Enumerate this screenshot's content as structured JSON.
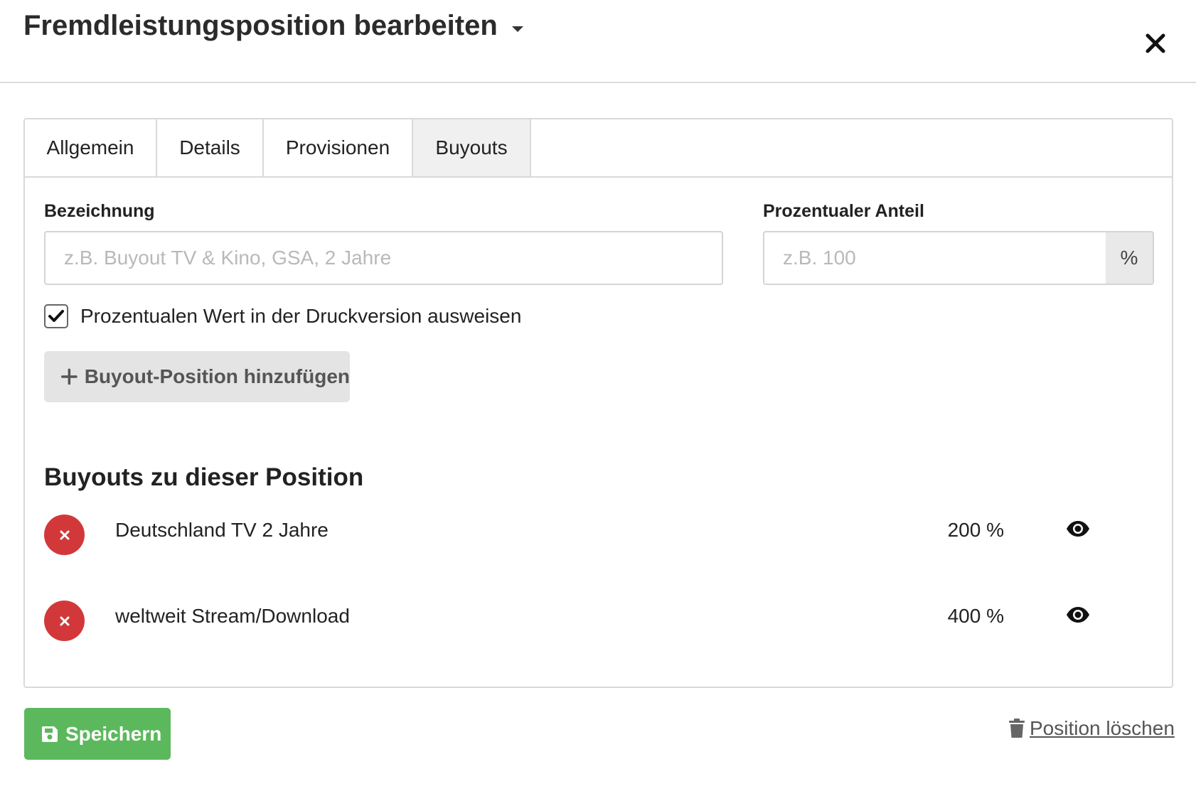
{
  "header": {
    "title": "Fremdleistungsposition bearbeiten",
    "dropdown_icon": "caret-down-icon",
    "close_icon": "close-icon"
  },
  "tabs": [
    {
      "label": "Allgemein",
      "active": false
    },
    {
      "label": "Details",
      "active": false
    },
    {
      "label": "Provisionen",
      "active": false
    },
    {
      "label": "Buyouts",
      "active": true
    }
  ],
  "form": {
    "bezeichnung": {
      "label": "Bezeichnung",
      "value": "",
      "placeholder": "z.B. Buyout TV & Kino, GSA, 2 Jahre"
    },
    "anteil": {
      "label": "Prozentualer Anteil",
      "value": "",
      "placeholder": "z.B. 100",
      "unit": "%"
    },
    "show_percent": {
      "label": "Prozentualen Wert in der Druckversion ausweisen",
      "checked": true
    },
    "add_button": {
      "label": "Buyout-Position hinzufügen",
      "icon": "plus-icon"
    }
  },
  "buyouts": {
    "title": "Buyouts zu dieser Position",
    "items": [
      {
        "name": "Deutschland TV 2 Jahre",
        "percent": "200 %",
        "visible": true
      },
      {
        "name": "weltweit Stream/Download",
        "percent": "400 %",
        "visible": true
      }
    ]
  },
  "footer": {
    "save_label": "Speichern",
    "save_icon": "floppy-disk-icon",
    "delete_label": "Position löschen",
    "delete_icon": "trash-icon"
  },
  "colors": {
    "save": "#5cb85c",
    "remove": "#d2383a",
    "active_tab": "#f0f0f0",
    "border": "#d9d9d9"
  }
}
